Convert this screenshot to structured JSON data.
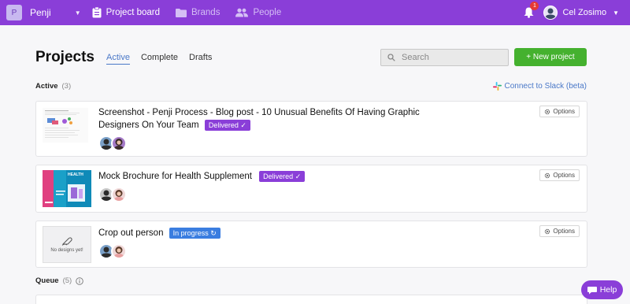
{
  "topbar": {
    "workspace_initial": "P",
    "workspace_name": "Penji",
    "nav": [
      {
        "label": "Project board"
      },
      {
        "label": "Brands"
      },
      {
        "label": "People"
      }
    ],
    "notification_count": "1",
    "user_name": "Cel Zosimo"
  },
  "header": {
    "title": "Projects",
    "tabs": [
      "Active",
      "Complete",
      "Drafts"
    ],
    "search_placeholder": "Search",
    "new_project": "+ New project"
  },
  "active_section": {
    "label": "Active",
    "count": "(3)"
  },
  "slack_link": "Connect to Slack (beta)",
  "projects": [
    {
      "title_line1": "Screenshot - Penji Process - Blog post - 10 Unusual Benefits Of Having Graphic",
      "title_line2": "Designers On Your Team",
      "status": "Delivered ✓",
      "options": "Options"
    },
    {
      "title": "Mock Brochure for Health Supplement",
      "status": "Delivered ✓",
      "options": "Options",
      "thumb_text": "HEALTH"
    },
    {
      "title": "Crop out person",
      "status": "In progress ↻",
      "options": "Options",
      "thumb_text": "No designs yet!"
    }
  ],
  "queue_section": {
    "label": "Queue",
    "count": "(5)"
  },
  "help": "Help",
  "colors": {
    "brand": "#8a3ed8",
    "accent_green": "#45b12f",
    "link": "#4a78c8",
    "in_progress": "#3a7de0"
  }
}
